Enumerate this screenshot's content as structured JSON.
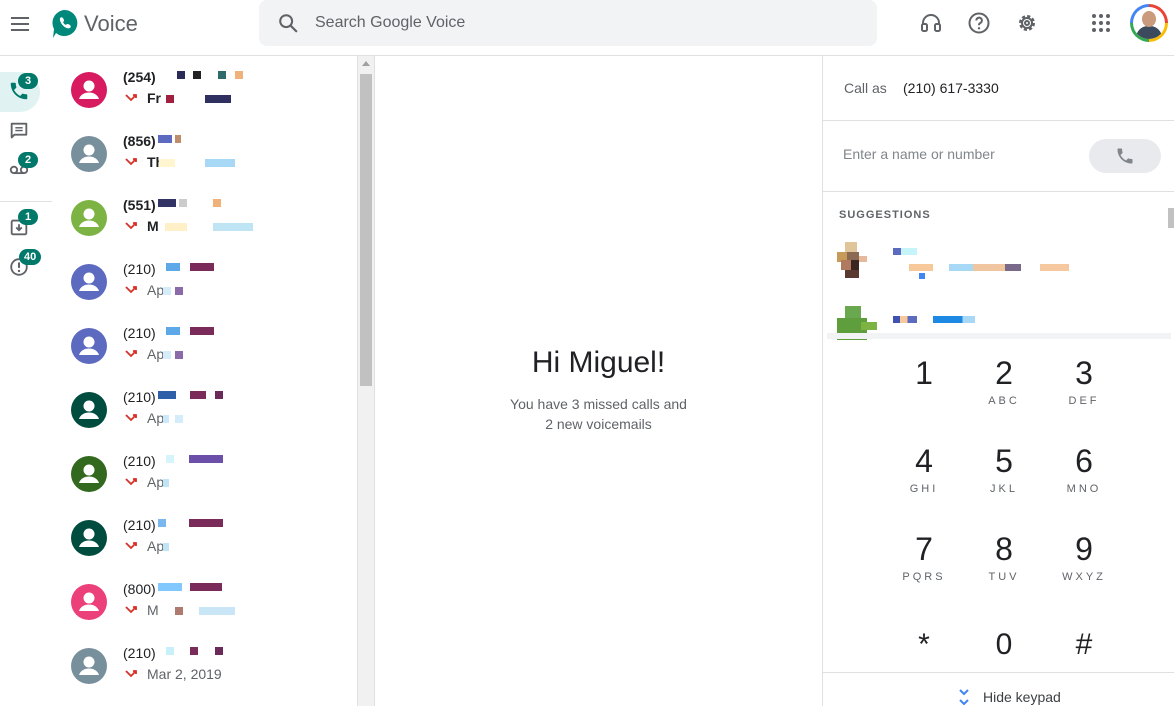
{
  "header": {
    "brand": "Voice",
    "search_placeholder": "Search Google Voice"
  },
  "rail": {
    "calls_badge": "3",
    "voicemail_badge": "2",
    "archive_badge": "1",
    "spam_badge": "40"
  },
  "conversations": [
    {
      "number": "(254)",
      "preview": "Fr",
      "unread": true,
      "avatar_color": "#d81b60"
    },
    {
      "number": "(856)",
      "preview": "Th",
      "unread": true,
      "avatar_color": "#78909c"
    },
    {
      "number": "(551)",
      "preview": "M",
      "unread": true,
      "avatar_color": "#7cb342"
    },
    {
      "number": "(210)",
      "preview": "Ap",
      "unread": false,
      "avatar_color": "#5c6bc0"
    },
    {
      "number": "(210)",
      "preview": "Ap",
      "unread": false,
      "avatar_color": "#5c6bc0"
    },
    {
      "number": "(210)",
      "preview": "Ap",
      "unread": false,
      "avatar_color": "#004d40"
    },
    {
      "number": "(210)",
      "preview": "Ap",
      "unread": false,
      "avatar_color": "#33691e"
    },
    {
      "number": "(210)",
      "preview": "Ap",
      "unread": false,
      "avatar_color": "#004d40"
    },
    {
      "number": "(800)",
      "preview": "M",
      "unread": false,
      "avatar_color": "#ec407a"
    },
    {
      "number": "(210)",
      "preview": "Mar 2, 2019",
      "unread": false,
      "avatar_color": "#78909c"
    }
  ],
  "center": {
    "greeting": "Hi Miguel!",
    "summary_line1": "You have 3 missed calls and",
    "summary_line2": "2 new voicemails"
  },
  "dialer": {
    "call_as_label": "Call as",
    "call_as_number": "(210) 617-3330",
    "input_placeholder": "Enter a name or number",
    "suggestions_title": "SUGGESTIONS",
    "keys": [
      {
        "digit": "1",
        "letters": ""
      },
      {
        "digit": "2",
        "letters": "ABC"
      },
      {
        "digit": "3",
        "letters": "DEF"
      },
      {
        "digit": "4",
        "letters": "GHI"
      },
      {
        "digit": "5",
        "letters": "JKL"
      },
      {
        "digit": "6",
        "letters": "MNO"
      },
      {
        "digit": "7",
        "letters": "PQRS"
      },
      {
        "digit": "8",
        "letters": "TUV"
      },
      {
        "digit": "9",
        "letters": "WXYZ"
      },
      {
        "digit": "*",
        "letters": ""
      },
      {
        "digit": "0",
        "letters": ""
      },
      {
        "digit": "#",
        "letters": ""
      }
    ],
    "hide_keypad_label": "Hide keypad"
  },
  "colors": {
    "accent": "#00796b",
    "missed": "#d93025"
  }
}
